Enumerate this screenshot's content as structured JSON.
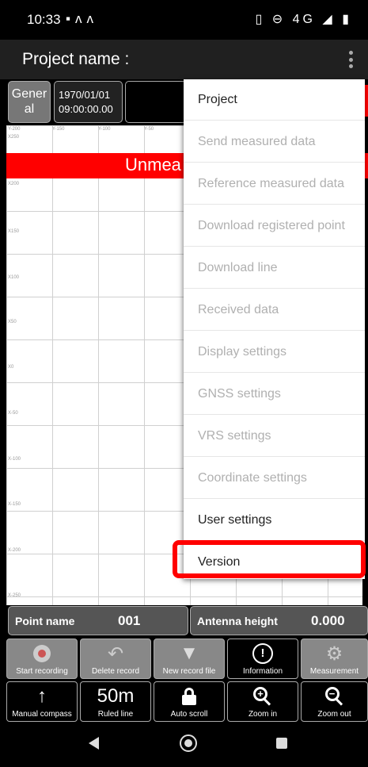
{
  "status_bar": {
    "time": "10:33",
    "left_icons": [
      "image-icon",
      "m-app-icon"
    ],
    "right_icons": [
      "vibrate-icon",
      "dnd-icon",
      "4g-icon",
      "signal-icon",
      "battery-icon"
    ],
    "network_label": "4G"
  },
  "app_bar": {
    "title": "Project name :"
  },
  "info_row": {
    "category": "Gener al",
    "date": "1970/01/01",
    "time": "09:00:00.00"
  },
  "graph": {
    "x_ticks": [
      "Y-200",
      "Y-150",
      "Y-100",
      "Y-50"
    ],
    "y_ticks": [
      "X250",
      "X200",
      "X150",
      "X100",
      "X50",
      "X0",
      "X-50",
      "X-100",
      "X-150",
      "X-200",
      "X-250"
    ]
  },
  "banner": {
    "text": "Unmea"
  },
  "menu": {
    "items": [
      {
        "label": "Project",
        "enabled": true
      },
      {
        "label": "Send measured data",
        "enabled": false
      },
      {
        "label": "Reference measured data",
        "enabled": false
      },
      {
        "label": "Download registered point",
        "enabled": false
      },
      {
        "label": "Download line",
        "enabled": false
      },
      {
        "label": "Received data",
        "enabled": false
      },
      {
        "label": "Display settings",
        "enabled": false
      },
      {
        "label": "GNSS settings",
        "enabled": false
      },
      {
        "label": "VRS settings",
        "enabled": false
      },
      {
        "label": "Coordinate settings",
        "enabled": false
      },
      {
        "label": "User settings",
        "enabled": true
      },
      {
        "label": "Version",
        "enabled": true
      }
    ],
    "highlighted": "Version",
    "highlight_color": "#ff0000"
  },
  "point": {
    "name_label": "Point name",
    "name_value": "001",
    "antenna_label": "Antenna height",
    "antenna_value": "0.000"
  },
  "toolbar1": [
    {
      "label": "Start recording",
      "icon": "record-icon",
      "enabled": false
    },
    {
      "label": "Delete record",
      "icon": "undo-icon",
      "enabled": false
    },
    {
      "label": "New record file",
      "icon": "new-file-icon",
      "enabled": false
    },
    {
      "label": "Information",
      "icon": "info-icon",
      "enabled": true
    },
    {
      "label": "Measurement",
      "icon": "gear-icon",
      "enabled": false
    }
  ],
  "toolbar2": [
    {
      "label": "Manual compass",
      "icon": "arrow-up-icon",
      "enabled": true
    },
    {
      "label": "Ruled line",
      "value": "50m",
      "enabled": true
    },
    {
      "label": "Auto scroll",
      "icon": "lock-icon",
      "enabled": true
    },
    {
      "label": "Zoom in",
      "icon": "zoom-in-icon",
      "enabled": true
    },
    {
      "label": "Zoom out",
      "icon": "zoom-out-icon",
      "enabled": true
    }
  ],
  "colors": {
    "accent_red": "#ff0000",
    "disabled_button": "#888888",
    "app_bar": "#202020"
  }
}
